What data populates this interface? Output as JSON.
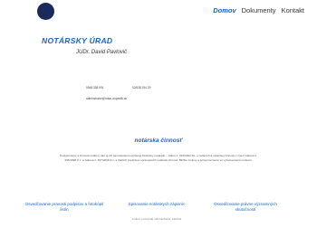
{
  "nav": {
    "items": [
      {
        "label": "Domov",
        "active": true
      },
      {
        "label": "Dokumenty",
        "active": false
      },
      {
        "label": "Kontakt",
        "active": false
      }
    ]
  },
  "header": {
    "title": "NOTÁRSKY ÚRAD",
    "subtitle": "JUDr. David Pavlovič"
  },
  "contact": {
    "phone1": "0948 338 991",
    "phone2": "02/638 194 29",
    "email": "adminstrator@notar-dupavlik.sk"
  },
  "section": {
    "title": "notárska činnosť",
    "description": "Poskytovanie a činnosti notárov, ako aj ich samosprávnu upravuje Notársky poriadok – zákon č. 323/1992 Zb. o notároch a notárskej činnosti v znení zákona č. 333/1998 Z.z. a zákona č. 397/2000 Z.z. a ďalších predpisov upravujúcich notársku činnosť. Bližšie zmluvy a splnomocnenia sú vyhotovované notárom."
  },
  "cards": [
    {
      "title": "Osvedčovanie pravosti podpisov a fotokópií listín"
    },
    {
      "title": "Spisovanie notárskych zápisníc",
      "subtitle": "zmluvy o prevode nehnuteľností, záložné"
    },
    {
      "title": "Osvedčovanie právne významných skutočností"
    }
  ],
  "colors": {
    "accent": "#1565c0",
    "logo": "#1a2a5a"
  }
}
